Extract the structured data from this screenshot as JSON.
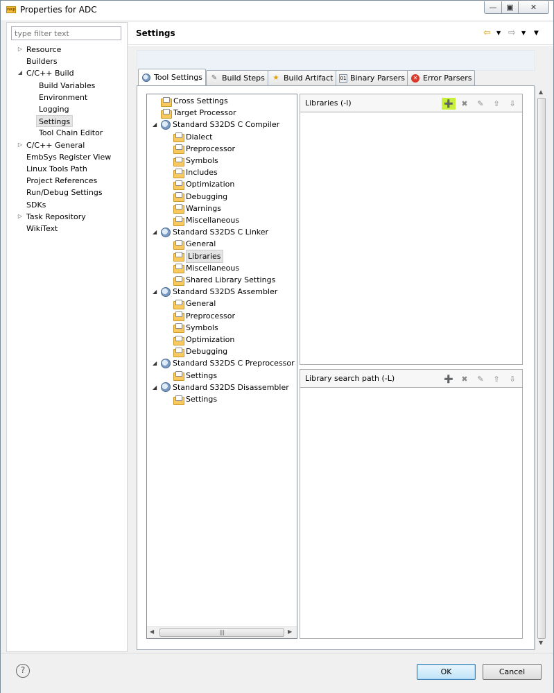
{
  "window": {
    "title": "Properties for ADC",
    "app_icon": "nxp-icon",
    "controls": [
      "minimize",
      "maximize",
      "close"
    ]
  },
  "left_pane": {
    "filter_placeholder": "type filter text",
    "items": [
      {
        "label": "Resource",
        "level": 0,
        "expander": "collapsed"
      },
      {
        "label": "Builders",
        "level": 0,
        "expander": "none"
      },
      {
        "label": "C/C++ Build",
        "level": 0,
        "expander": "expanded"
      },
      {
        "label": "Build Variables",
        "level": 1,
        "expander": "none"
      },
      {
        "label": "Environment",
        "level": 1,
        "expander": "none"
      },
      {
        "label": "Logging",
        "level": 1,
        "expander": "none"
      },
      {
        "label": "Settings",
        "level": 1,
        "expander": "none",
        "selected": true
      },
      {
        "label": "Tool Chain Editor",
        "level": 1,
        "expander": "none"
      },
      {
        "label": "C/C++ General",
        "level": 0,
        "expander": "collapsed"
      },
      {
        "label": "EmbSys Register View",
        "level": 0,
        "expander": "none"
      },
      {
        "label": "Linux Tools Path",
        "level": 0,
        "expander": "none"
      },
      {
        "label": "Project References",
        "level": 0,
        "expander": "none"
      },
      {
        "label": "Run/Debug Settings",
        "level": 0,
        "expander": "none"
      },
      {
        "label": "SDKs",
        "level": 0,
        "expander": "none"
      },
      {
        "label": "Task Repository",
        "level": 0,
        "expander": "collapsed"
      },
      {
        "label": "WikiText",
        "level": 0,
        "expander": "none"
      }
    ]
  },
  "header": {
    "title": "Settings",
    "back_icon": "arrow-left-icon",
    "forward_icon": "arrow-right-icon",
    "menu_icon": "view-menu-icon"
  },
  "tabs": [
    {
      "label": "Tool Settings",
      "icon": "tool-settings-icon",
      "active": true
    },
    {
      "label": "Build Steps",
      "icon": "build-steps-icon"
    },
    {
      "label": "Build Artifact",
      "icon": "trophy-icon"
    },
    {
      "label": "Binary Parsers",
      "icon": "binary-icon"
    },
    {
      "label": "Error Parsers",
      "icon": "error-icon"
    }
  ],
  "tool_tree": [
    {
      "label": "Cross Settings",
      "level": 1,
      "icon": "folder-icon"
    },
    {
      "label": "Target Processor",
      "level": 1,
      "icon": "folder-icon"
    },
    {
      "label": "Standard S32DS C Compiler",
      "level": 0,
      "icon": "tool-icon",
      "expander": "expanded"
    },
    {
      "label": "Dialect",
      "level": 2,
      "icon": "folder-icon"
    },
    {
      "label": "Preprocessor",
      "level": 2,
      "icon": "folder-icon"
    },
    {
      "label": "Symbols",
      "level": 2,
      "icon": "folder-icon"
    },
    {
      "label": "Includes",
      "level": 2,
      "icon": "folder-icon"
    },
    {
      "label": "Optimization",
      "level": 2,
      "icon": "folder-icon"
    },
    {
      "label": "Debugging",
      "level": 2,
      "icon": "folder-icon"
    },
    {
      "label": "Warnings",
      "level": 2,
      "icon": "folder-icon"
    },
    {
      "label": "Miscellaneous",
      "level": 2,
      "icon": "folder-icon"
    },
    {
      "label": "Standard S32DS C Linker",
      "level": 0,
      "icon": "tool-icon",
      "expander": "expanded"
    },
    {
      "label": "General",
      "level": 2,
      "icon": "folder-icon"
    },
    {
      "label": "Libraries",
      "level": 2,
      "icon": "folder-icon",
      "selected": true
    },
    {
      "label": "Miscellaneous",
      "level": 2,
      "icon": "folder-icon"
    },
    {
      "label": "Shared Library Settings",
      "level": 2,
      "icon": "folder-icon"
    },
    {
      "label": "Standard S32DS Assembler",
      "level": 0,
      "icon": "tool-icon",
      "expander": "expanded"
    },
    {
      "label": "General",
      "level": 2,
      "icon": "folder-icon"
    },
    {
      "label": "Preprocessor",
      "level": 2,
      "icon": "folder-icon"
    },
    {
      "label": "Symbols",
      "level": 2,
      "icon": "folder-icon"
    },
    {
      "label": "Optimization",
      "level": 2,
      "icon": "folder-icon"
    },
    {
      "label": "Debugging",
      "level": 2,
      "icon": "folder-icon"
    },
    {
      "label": "Standard S32DS C Preprocessor",
      "level": 0,
      "icon": "tool-icon",
      "expander": "expanded"
    },
    {
      "label": "Settings",
      "level": 2,
      "icon": "folder-icon"
    },
    {
      "label": "Standard S32DS Disassembler",
      "level": 0,
      "icon": "tool-icon",
      "expander": "expanded"
    },
    {
      "label": "Settings",
      "level": 2,
      "icon": "folder-icon"
    }
  ],
  "libraries_panel": {
    "title": "Libraries (-l)",
    "tools": [
      "add-icon",
      "delete-icon",
      "edit-icon",
      "move-up-icon",
      "move-down-icon"
    ],
    "highlighted_tool": "add-icon",
    "items": []
  },
  "search_path_panel": {
    "title": "Library search path (-L)",
    "tools": [
      "add-icon",
      "delete-icon",
      "edit-icon",
      "move-up-icon",
      "move-down-icon"
    ],
    "items": []
  },
  "footer": {
    "help_label": "?",
    "ok_label": "OK",
    "cancel_label": "Cancel"
  },
  "colors": {
    "highlight": "#c6f03a",
    "selection": "#e5e5e5",
    "ok_border": "#3c7fb1"
  }
}
